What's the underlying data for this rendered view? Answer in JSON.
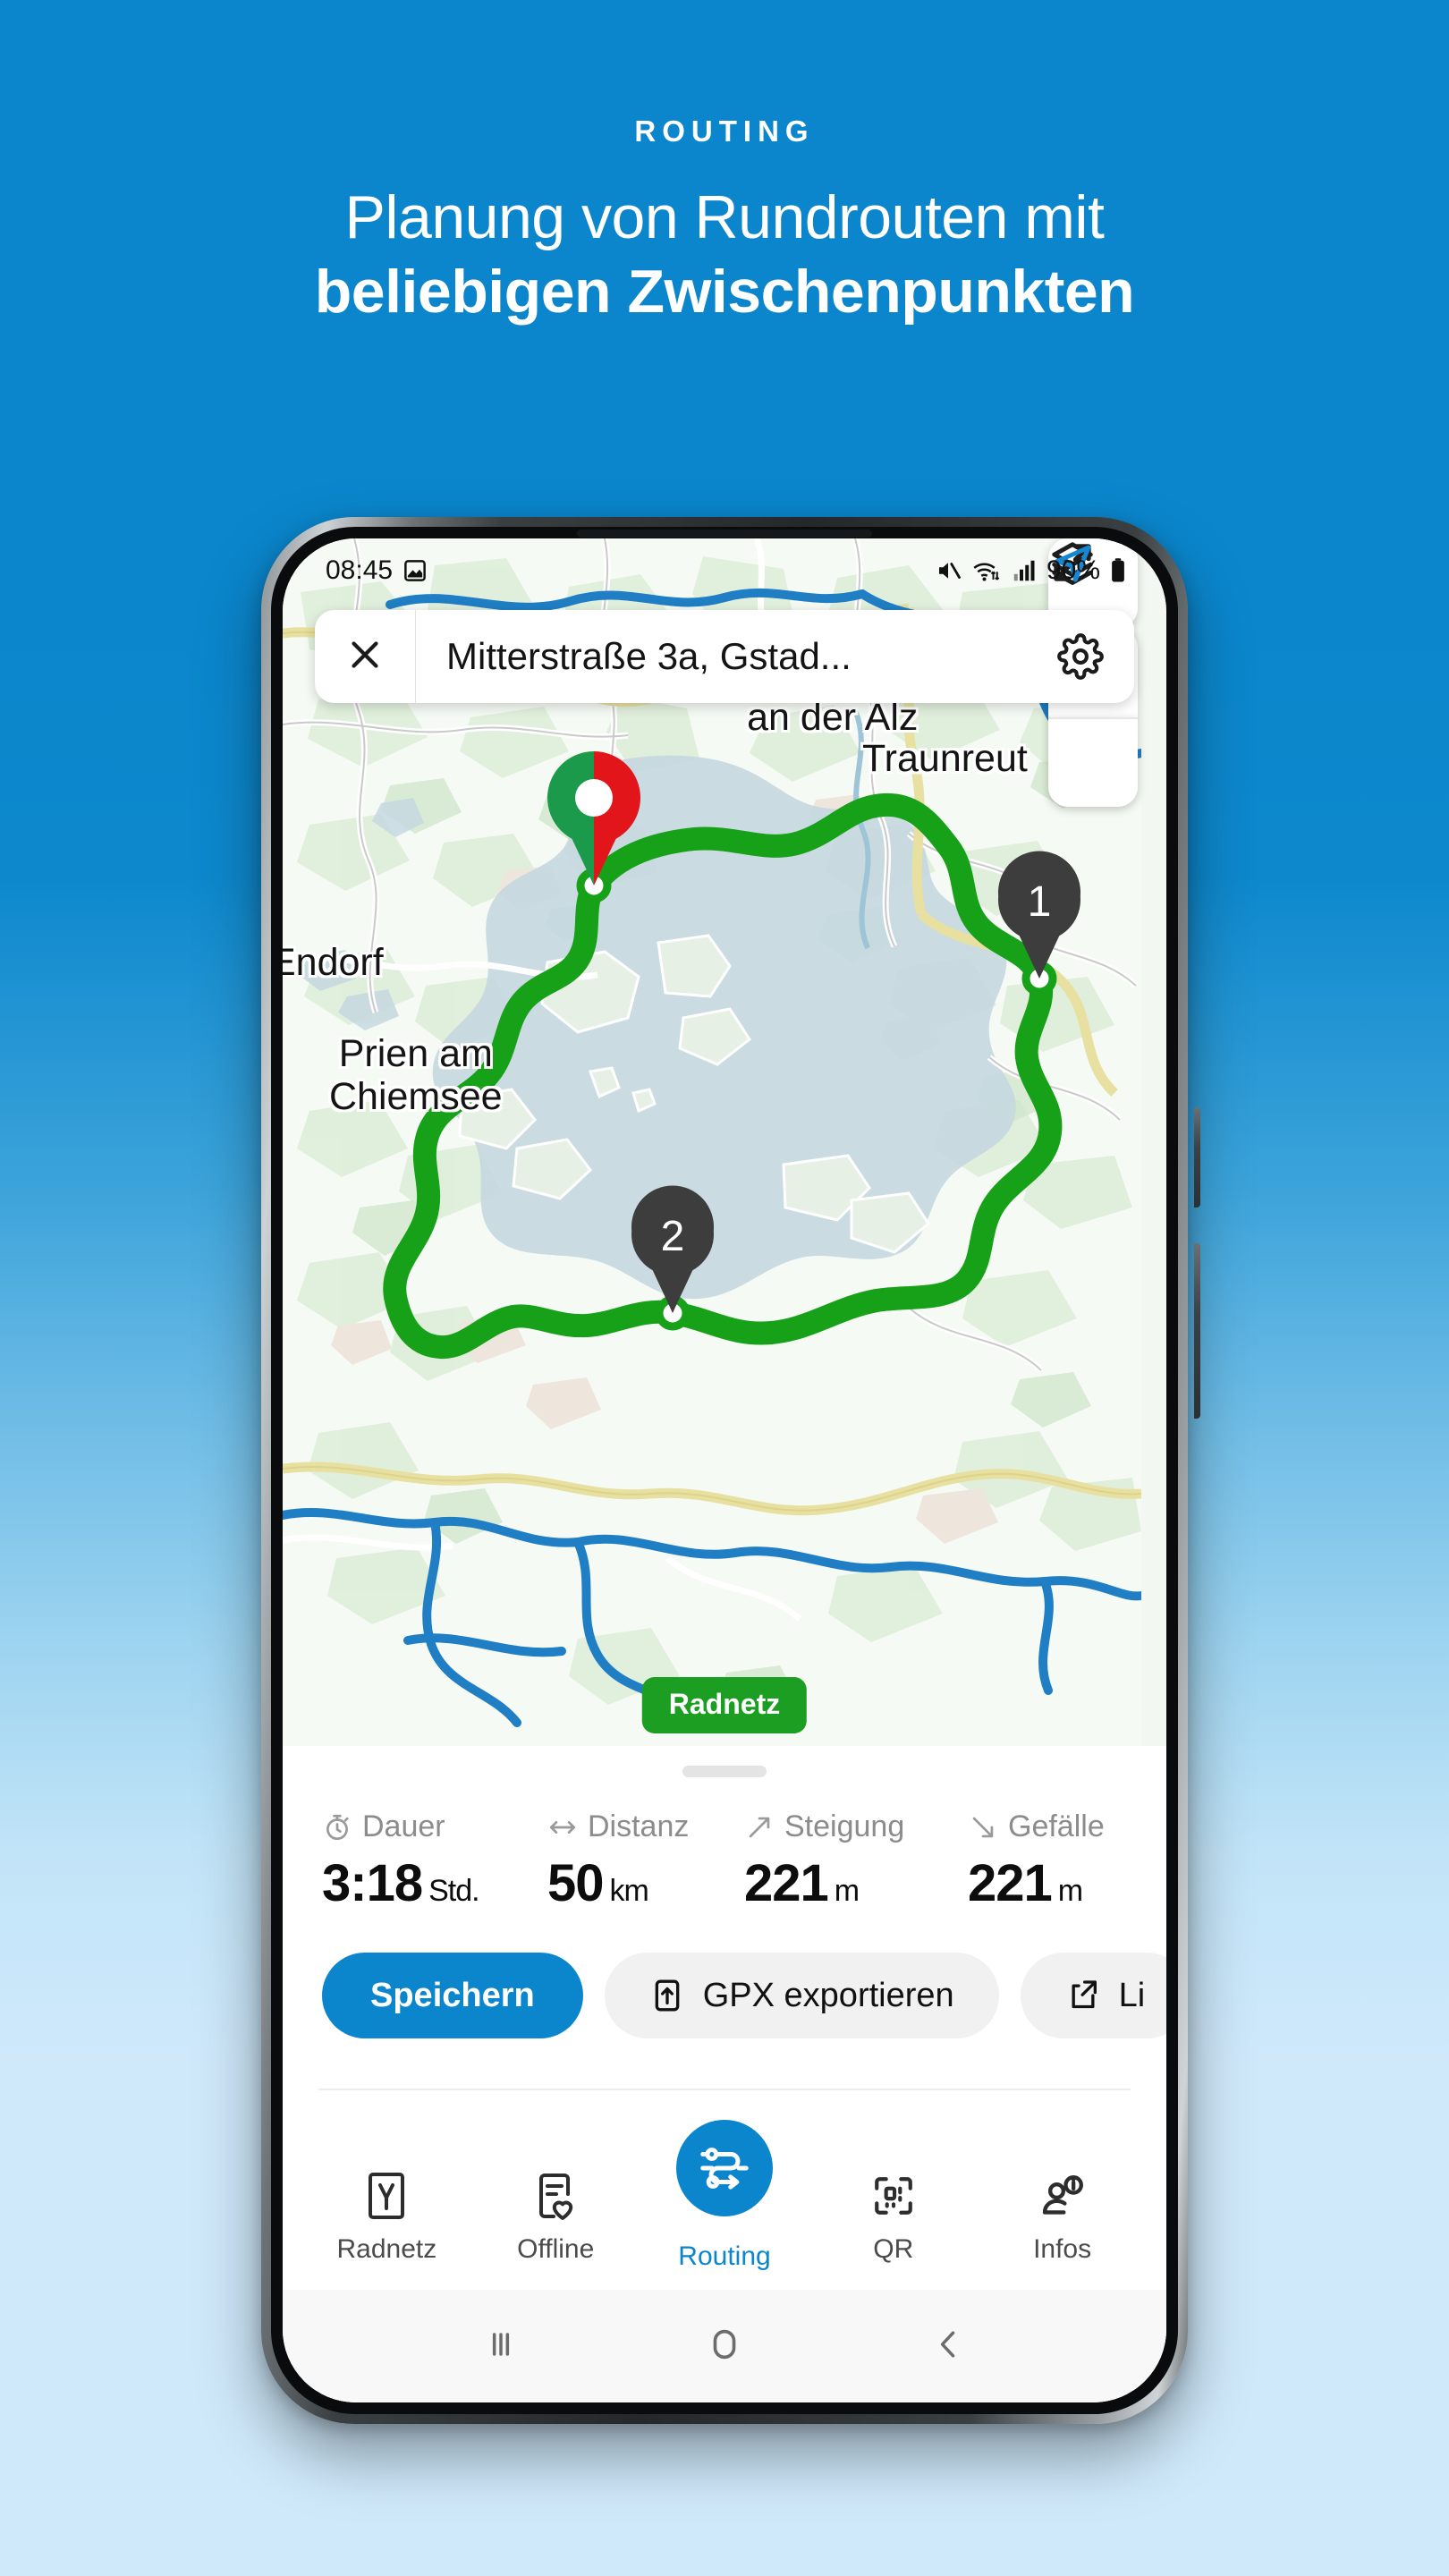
{
  "header": {
    "eyebrow": "ROUTING",
    "line1": "Planung von Rundrouten mit",
    "line2": "beliebigen Zwischenpunkten"
  },
  "phone": {
    "statusbar": {
      "time": "08:45",
      "battery_percent": "90%",
      "icons": [
        "screenshot-icon",
        "mute-icon",
        "wifi-icon",
        "signal-icon",
        "battery-icon"
      ]
    },
    "search": {
      "value": "Mitterstraße 3a, Gstad...",
      "close_icon": "close-icon",
      "settings_icon": "gear-icon"
    },
    "map": {
      "labels": [
        {
          "name": "altenmarkt",
          "text": "Altenmarkt\nan der Alz"
        },
        {
          "name": "traunreut",
          "text": "Traunreut"
        },
        {
          "name": "endorf",
          "text": "Endorf"
        },
        {
          "name": "prien",
          "text": "Prien am\nChiemsee"
        }
      ],
      "route_badge": "Radnetz",
      "waypoints": [
        {
          "label": "1"
        },
        {
          "label": "2"
        }
      ],
      "controls": [
        {
          "name": "fullscreen-button",
          "icon": "expand-icon"
        },
        {
          "name": "layers-button",
          "icon": "layers-icon"
        },
        {
          "name": "locate-button",
          "icon": "navigation-arrow-icon"
        }
      ],
      "colors": {
        "route": "#17a119",
        "start": "#1a9a4a",
        "end": "#e2151a",
        "waypoint": "#3d3d3d",
        "badge": "#1b9e21"
      }
    },
    "sheet": {
      "stats": [
        {
          "icon": "timer-icon",
          "label": "Dauer",
          "value": "3:18",
          "unit": "Std."
        },
        {
          "icon": "distance-icon",
          "label": "Distanz",
          "value": "50",
          "unit": "km"
        },
        {
          "icon": "ascent-icon",
          "label": "Steigung",
          "value": "221",
          "unit": "m"
        },
        {
          "icon": "descent-icon",
          "label": "Gefälle",
          "value": "221",
          "unit": "m"
        }
      ],
      "actions": [
        {
          "name": "save-button",
          "label": "Speichern",
          "icon": null,
          "style": "primary"
        },
        {
          "name": "export-button",
          "label": "GPX exportieren",
          "icon": "upload-icon",
          "style": "ghost"
        },
        {
          "name": "share-button",
          "label": "Li",
          "icon": "share-icon",
          "style": "ghost"
        }
      ]
    },
    "bottomnav": {
      "items": [
        {
          "name": "radnetz",
          "label": "Radnetz",
          "icon": "y-logo-icon",
          "active": false
        },
        {
          "name": "offline",
          "label": "Offline",
          "icon": "offline-heart-icon",
          "active": false
        },
        {
          "name": "routing",
          "label": "Routing",
          "icon": "route-icon",
          "active": true
        },
        {
          "name": "qr",
          "label": "QR",
          "icon": "qr-icon",
          "active": false
        },
        {
          "name": "infos",
          "label": "Infos",
          "icon": "info-person-icon",
          "active": false
        }
      ]
    },
    "androidbar": {
      "recents": "recents-icon",
      "home": "home-icon",
      "back": "back-icon"
    }
  },
  "colors": {
    "brand_blue": "#0b86cc",
    "bg_top": "#0b86cc",
    "bg_bottom": "#cfe9fb",
    "accent_green": "#17a119"
  }
}
